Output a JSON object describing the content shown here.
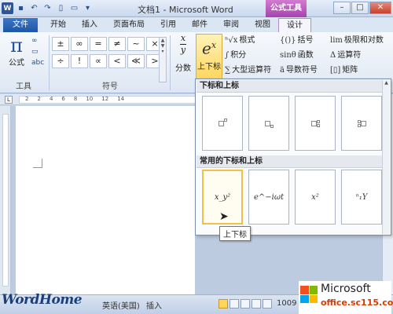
{
  "window": {
    "title": "文档1 - Microsoft Word",
    "context_tab": "公式工具",
    "controls": [
      "–",
      "□",
      "✕"
    ]
  },
  "tabs": [
    {
      "label": "文件"
    },
    {
      "label": "开始"
    },
    {
      "label": "插入"
    },
    {
      "label": "页面布局"
    },
    {
      "label": "引用"
    },
    {
      "label": "邮件"
    },
    {
      "label": "审阅"
    },
    {
      "label": "视图"
    },
    {
      "label": "设计"
    }
  ],
  "ribbon": {
    "tools": {
      "formula_label": "公式",
      "formula_symbol": "π",
      "group_label": "工具",
      "small_icons": [
        "∞",
        "▭",
        "abc"
      ]
    },
    "symbols": {
      "group_label": "符号",
      "items": [
        "±",
        "∞",
        "=",
        "≠",
        "~",
        "×",
        "÷",
        "!",
        "∝",
        "<",
        "≪",
        ">"
      ]
    },
    "fraction": {
      "label": "分数",
      "top": "x",
      "bottom": "y"
    },
    "script": {
      "label": "上下标",
      "base": "e",
      "sup": "x"
    },
    "structures_col1": [
      {
        "icon": "ⁿ√x",
        "label": "根式"
      },
      {
        "icon": "∫",
        "label": "积分"
      },
      {
        "icon": "∑",
        "label": "大型运算符"
      }
    ],
    "structures_col2": [
      {
        "icon": "{()}",
        "label": "括号"
      },
      {
        "icon": "sinθ",
        "label": "函数"
      },
      {
        "icon": "ä",
        "label": "导数符号"
      }
    ],
    "structures_col3": [
      {
        "icon": "lim",
        "label": "极限和对数"
      },
      {
        "icon": "Δ",
        "label": "运算符"
      },
      {
        "icon": "[▯]",
        "label": "矩阵"
      }
    ]
  },
  "ruler": {
    "numbers": [
      "2",
      "2",
      "4",
      "6",
      "8",
      "10",
      "12",
      "14"
    ]
  },
  "gallery": {
    "section1": "下标和上标",
    "section2": "常用的下标和上标",
    "common": [
      "x_y²",
      "e^−iωt",
      "x²",
      "ⁿ₁Y"
    ],
    "tooltip": "上下标"
  },
  "status": {
    "language": "英语(美国)",
    "mode": "插入",
    "zoom": "1009"
  },
  "watermark": {
    "left": "WordHome",
    "brand": "Microsoft",
    "site": "office.sc115.com"
  }
}
